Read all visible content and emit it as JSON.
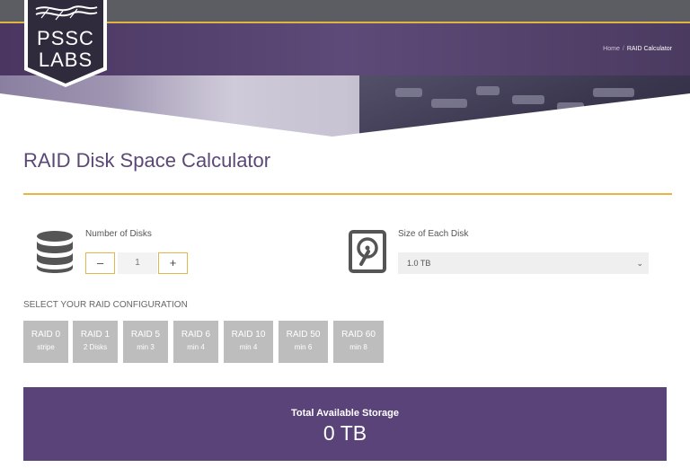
{
  "header": {
    "logo_line1": "PSSC",
    "logo_line2": "LABS",
    "breadcrumb": {
      "home": "Home",
      "separator": "/",
      "current": "RAID Calculator"
    }
  },
  "page": {
    "title": "RAID Disk Space Calculator"
  },
  "disks": {
    "label": "Number of Disks",
    "decrement_label": "–",
    "increment_label": "+",
    "value": "1"
  },
  "disk_size": {
    "label": "Size of Each Disk",
    "selected": "1.0 TB",
    "chevron": "⌄"
  },
  "raid": {
    "heading": "SELECT YOUR RAID CONFIGURATION",
    "options": [
      {
        "name": "RAID 0",
        "sub": "stripe"
      },
      {
        "name": "RAID 1",
        "sub": "2 Disks"
      },
      {
        "name": "RAID 5",
        "sub": "min 3"
      },
      {
        "name": "RAID 6",
        "sub": "min 4"
      },
      {
        "name": "RAID 10",
        "sub": "min 4"
      },
      {
        "name": "RAID 50",
        "sub": "min 6"
      },
      {
        "name": "RAID 60",
        "sub": "min 8"
      }
    ]
  },
  "result": {
    "label": "Total Available Storage",
    "value": "0 TB"
  },
  "colors": {
    "brand_purple": "#5a4379",
    "accent_gold": "#e3b54b",
    "raid_button_gray": "#bdbdbd"
  }
}
